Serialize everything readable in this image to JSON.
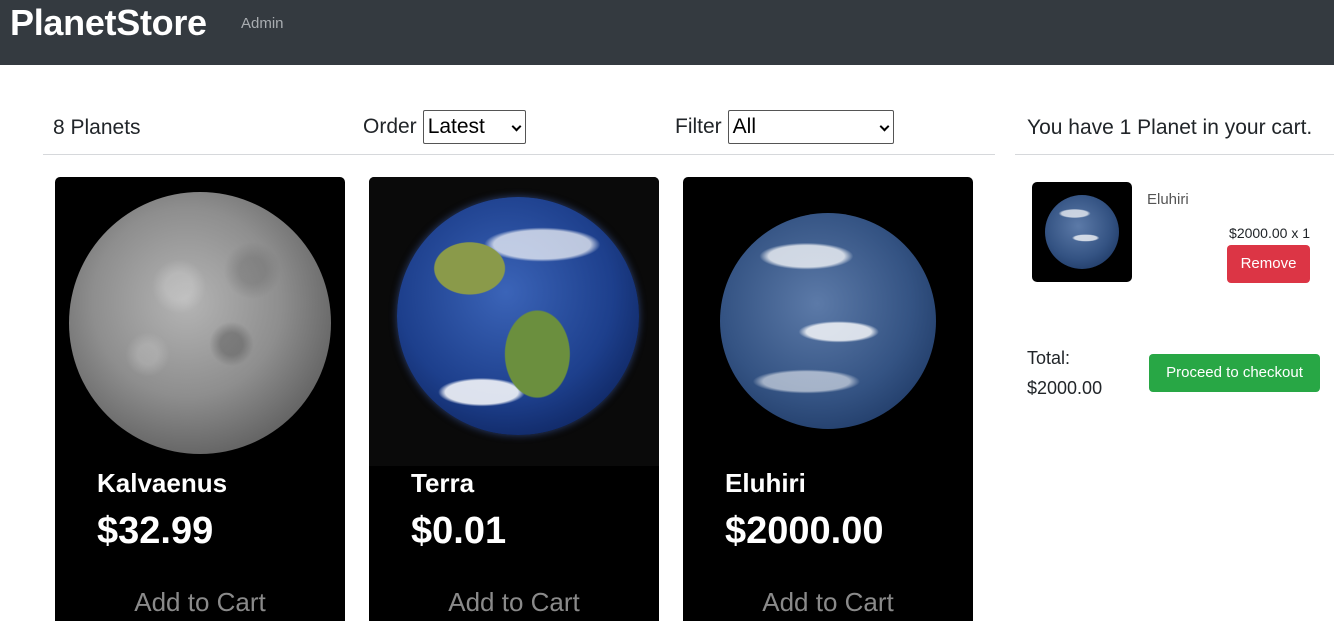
{
  "navbar": {
    "brand": "PlanetStore",
    "link": "Admin",
    "bg": "#343a40"
  },
  "filters": {
    "count_label": "8 Planets",
    "order_label": "Order",
    "order_value": "Latest",
    "filter_label": "Filter",
    "filter_value": "All"
  },
  "products": [
    {
      "name": "Kalvaenus",
      "price": "$32.99",
      "add_label": "Add to Cart",
      "image": "mercury-like-grey-planet"
    },
    {
      "name": "Terra",
      "price": "$0.01",
      "add_label": "Add to Cart",
      "image": "earth-planet"
    },
    {
      "name": "Eluhiri",
      "price": "$2000.00",
      "add_label": "Add to Cart",
      "image": "blue-cloudy-planet"
    }
  ],
  "cart": {
    "summary": "You have 1 Planet in your cart.",
    "items": [
      {
        "name": "Eluhiri",
        "price_qty": "$2000.00 x 1",
        "remove_label": "Remove",
        "image": "blue-cloudy-planet"
      }
    ],
    "total_label": "Total:",
    "total_value": "$2000.00",
    "checkout_label": "Proceed to checkout"
  },
  "colors": {
    "remove": "#dc3545",
    "checkout": "#28a745",
    "card": "#000000"
  }
}
